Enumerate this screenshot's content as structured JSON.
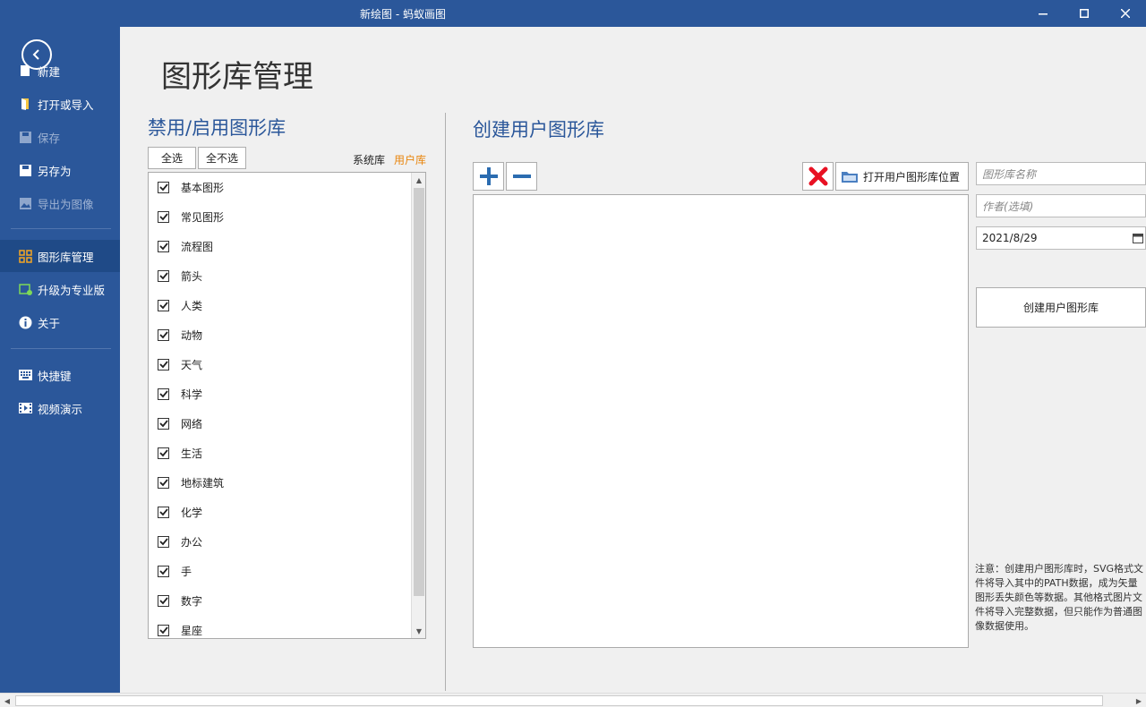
{
  "window": {
    "title": "新绘图 - 蚂蚁画图"
  },
  "sidebar": {
    "items": [
      {
        "label": "新建",
        "icon": "new-file-icon",
        "state": "normal"
      },
      {
        "label": "打开或导入",
        "icon": "open-folder-icon",
        "state": "normal"
      },
      {
        "label": "保存",
        "icon": "save-icon",
        "state": "disabled"
      },
      {
        "label": "另存为",
        "icon": "save-as-icon",
        "state": "normal"
      },
      {
        "label": "导出为图像",
        "icon": "export-image-icon",
        "state": "disabled"
      },
      {
        "label": "图形库管理",
        "icon": "library-grid-icon",
        "state": "active"
      },
      {
        "label": "升级为专业版",
        "icon": "upgrade-icon",
        "state": "normal"
      },
      {
        "label": "关于",
        "icon": "info-icon",
        "state": "normal"
      },
      {
        "label": "快捷键",
        "icon": "keyboard-icon",
        "state": "normal"
      },
      {
        "label": "视频演示",
        "icon": "video-icon",
        "state": "normal"
      }
    ]
  },
  "main": {
    "title": "图形库管理",
    "left_section": {
      "title": "禁用/启用图形库",
      "select_all": "全选",
      "select_none": "全不选",
      "tab_system": "系统库",
      "tab_user": "用户库",
      "libraries": [
        {
          "name": "基本图形",
          "checked": true
        },
        {
          "name": "常见图形",
          "checked": true
        },
        {
          "name": "流程图",
          "checked": true
        },
        {
          "name": "箭头",
          "checked": true
        },
        {
          "name": "人类",
          "checked": true
        },
        {
          "name": "动物",
          "checked": true
        },
        {
          "name": "天气",
          "checked": true
        },
        {
          "name": "科学",
          "checked": true
        },
        {
          "name": "网络",
          "checked": true
        },
        {
          "name": "生活",
          "checked": true
        },
        {
          "name": "地标建筑",
          "checked": true
        },
        {
          "name": "化学",
          "checked": true
        },
        {
          "name": "办公",
          "checked": true
        },
        {
          "name": "手",
          "checked": true
        },
        {
          "name": "数字",
          "checked": true
        },
        {
          "name": "星座",
          "checked": true
        }
      ]
    },
    "right_section": {
      "title": "创建用户图形库",
      "open_location": "打开用户图形库位置",
      "name_placeholder": "图形库名称",
      "author_placeholder": "作者(选填)",
      "date_value": "2021/8/29",
      "create_button": "创建用户图形库",
      "note": "注意：创建用户图形库时，SVG格式文件将导入其中的PATH数据，成为矢量图形丢失颜色等数据。其他格式图片文件将导入完整数据，但只能作为普通图像数据使用。"
    }
  },
  "colors": {
    "accent": "#2b579a",
    "tab_active": "#e8850c",
    "delete_red": "#e81123"
  }
}
